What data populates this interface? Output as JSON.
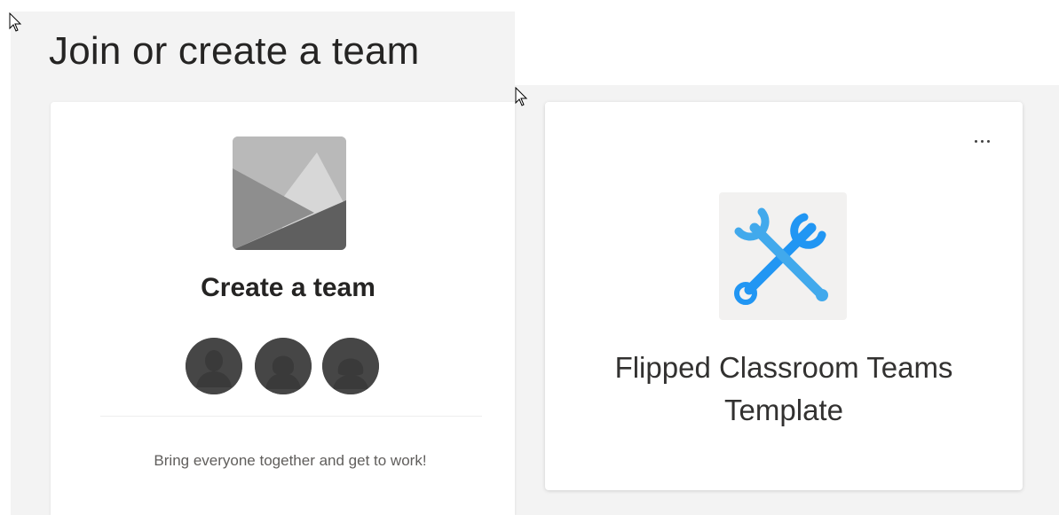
{
  "page": {
    "title": "Join or create a team"
  },
  "create_card": {
    "title": "Create a team",
    "description": "Bring everyone together and get to work!",
    "image_icon": "landscape-placeholder-icon",
    "avatar_icons": [
      "person-avatar-icon",
      "person-avatar-icon",
      "person-avatar-icon"
    ]
  },
  "template_card": {
    "name": "Flipped Classroom Teams Template",
    "icon": "crossed-wrenches-icon",
    "more_options_icon": "ellipsis-icon"
  },
  "colors": {
    "panel_background": "#f3f3f3",
    "card_background": "#ffffff",
    "avatar": "#464646",
    "wrench_blue": "#2196f3",
    "wrench_teal": "#41c3e8"
  }
}
